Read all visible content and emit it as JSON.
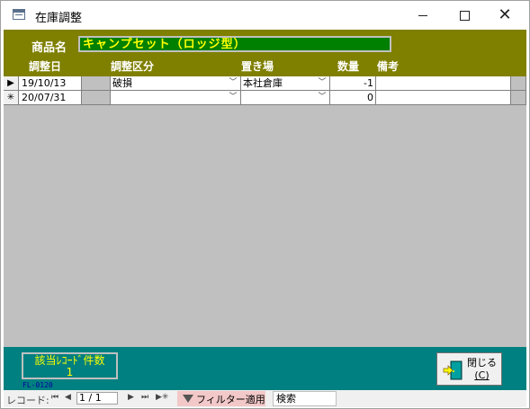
{
  "window": {
    "title": "在庫調整"
  },
  "header": {
    "product_label": "商品名",
    "product_value": "キャンプセット（ロッジ型）",
    "columns": {
      "date": "調整日",
      "category": "調整区分",
      "location": "置き場",
      "qty": "数量",
      "note": "備考"
    }
  },
  "rows": [
    {
      "marker": "▶",
      "date": "19/10/13",
      "category": "破損",
      "location": "本社倉庫",
      "qty": "-1",
      "note": ""
    },
    {
      "marker": "✳",
      "date": "20/07/31",
      "category": "",
      "location": "",
      "qty": "0",
      "note": ""
    }
  ],
  "footer": {
    "count_label": "該当ﾚｺｰﾄﾞ件数",
    "count_value": "1",
    "form_code": "FL-0120",
    "close_label": "閉じる",
    "close_key": "(C)"
  },
  "navbar": {
    "record_label": "レコード:",
    "first_icon": "⏮",
    "prev_icon": "◀",
    "position": "1 / 1",
    "next_icon": "▶",
    "last_icon": "⏭",
    "new_icon": "▶✳",
    "filter_label": "フィルター適用",
    "search_label": "検索"
  },
  "colors": {
    "header_bg": "#7f7f00",
    "footer_bg": "#008080",
    "product_bg": "#008000",
    "highlight_text": "#ffff00"
  }
}
